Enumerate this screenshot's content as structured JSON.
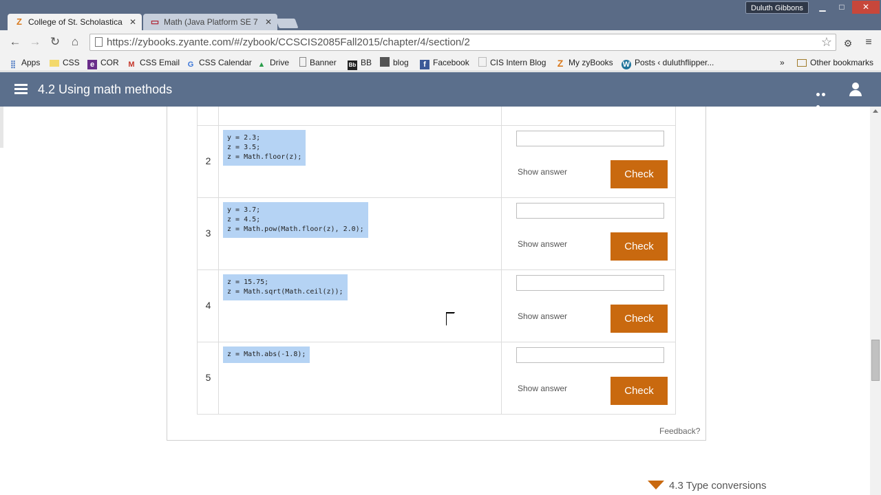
{
  "browser": {
    "user": "Duluth Gibbons",
    "window": {
      "minimize": "▁",
      "maximize": "□",
      "close": "✕"
    },
    "tabs": [
      {
        "title": "College of St. Scholastica",
        "favicon": "Z",
        "close": "✕"
      },
      {
        "title": "Math (Java Platform SE 7",
        "favicon": "▭",
        "close": "✕"
      }
    ],
    "nav": {
      "back": "←",
      "forward": "→",
      "reload": "↻",
      "home": "⌂"
    },
    "url": "https://zybooks.zyante.com/#/zybook/CCSCIS2085Fall2015/chapter/4/section/2",
    "star": "☆",
    "menu": "≡",
    "extension": "⚙",
    "bookmarks": [
      {
        "label": "Apps",
        "icon": "apps-icon"
      },
      {
        "label": "CSS",
        "icon": "folder-icon"
      },
      {
        "label": "COR",
        "icon": "e-icon"
      },
      {
        "label": "CSS Email",
        "icon": "gmail-icon"
      },
      {
        "label": "CSS Calendar",
        "icon": "google-icon"
      },
      {
        "label": "Drive",
        "icon": "drive-icon"
      },
      {
        "label": "Banner",
        "icon": "page-icon"
      },
      {
        "label": "BB",
        "icon": "bb-icon"
      },
      {
        "label": "blog",
        "icon": "blog-icon"
      },
      {
        "label": "Facebook",
        "icon": "facebook-icon"
      },
      {
        "label": "CIS Intern Blog",
        "icon": "page-icon"
      },
      {
        "label": "My zyBooks",
        "icon": "zybooks-icon"
      },
      {
        "label": "Posts ‹ duluthflipper...",
        "icon": "wordpress-icon"
      }
    ],
    "overflow": "»",
    "other_bookmarks": "Other bookmarks"
  },
  "header": {
    "title": "4.2 Using math methods"
  },
  "exercise": {
    "rows": [
      {
        "num": "2",
        "code": "y = 2.3;\nz = 3.5;\nz = Math.floor(z);",
        "show_answer": "Show answer",
        "check": "Check"
      },
      {
        "num": "3",
        "code": "y = 3.7;\nz = 4.5;\nz = Math.pow(Math.floor(z), 2.0);",
        "show_answer": "Show answer",
        "check": "Check"
      },
      {
        "num": "4",
        "code": "z = 15.75;\nz = Math.sqrt(Math.ceil(z));",
        "show_answer": "Show answer",
        "check": "Check"
      },
      {
        "num": "5",
        "code": "z = Math.abs(-1.8);",
        "show_answer": "Show answer",
        "check": "Check"
      }
    ],
    "feedback": "Feedback?"
  },
  "next_section": "4.3 Type conversions",
  "colors": {
    "accent": "#c9690f",
    "header": "#5b6f8c",
    "code_highlight": "#b5d3f4"
  }
}
